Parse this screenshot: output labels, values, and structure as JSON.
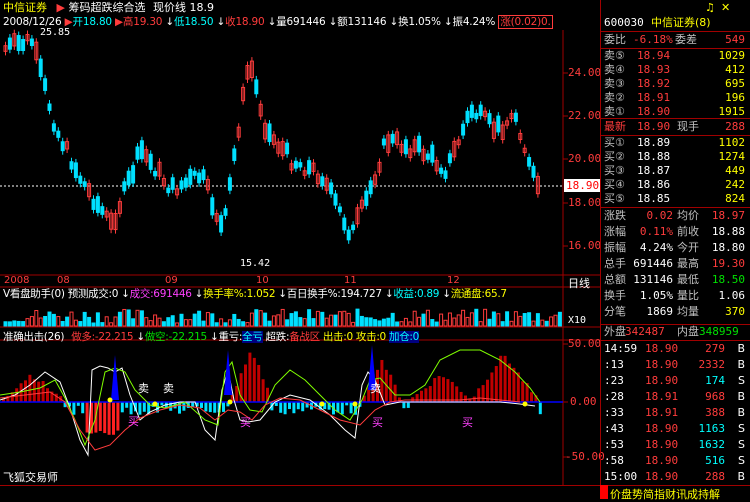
{
  "app": {
    "title": "中信证券",
    "icon_bell": "bell-icon"
  },
  "header": {
    "indicator_name": "筹码超跌综合选",
    "price_line": "现价线 18.9",
    "date": "2008/12/26",
    "open": "开18.80",
    "high": "高19.30",
    "low": "低18.50",
    "close": "收18.90",
    "volume": "量691446",
    "amount": "额131146",
    "turnover": "换1.05%",
    "amplitude": "振4.24%",
    "change": "涨(0.02)0."
  },
  "price_chart": {
    "high_label": "25.85",
    "low_label": "15.42",
    "current_tag": "18.90",
    "axis": [
      "24.00",
      "22.00",
      "20.00",
      "18.00",
      "16.00"
    ],
    "x_labels": [
      "2008",
      "08",
      "09",
      "10",
      "11",
      "12"
    ],
    "period": "日线"
  },
  "volume_panel": {
    "title": "V看盘助手(0)",
    "prefix": "预测成交:0",
    "vol": "成交:691446",
    "turn": "换手率%:1.052",
    "hundred": "百日换手%:194.727",
    "income": "收益:0.89",
    "float": "流通盘:65.7",
    "unit": "X10"
  },
  "bottom_panel": {
    "title": "准确出击(26)",
    "bull": "做多:-22.215",
    "bear": "做空:-22.215",
    "loss_label": "重亏:",
    "loss_val": "全亏",
    "plunge_label": "超跌:",
    "plunge_val": "备战区",
    "exit": "出击:0",
    "attack": "攻击:0",
    "add": "加仓:0",
    "axis": [
      "50.00",
      "0.00",
      "-50.00"
    ],
    "buy_marks": [
      "买",
      "买",
      "买",
      "买"
    ],
    "sell_marks": [
      "卖",
      "卖",
      "卖"
    ],
    "watermark": "飞狐交易师"
  },
  "quote": {
    "code": "600030",
    "name": "中信证券(8)",
    "ratio_label": "委比",
    "ratio_val": "-6.18%",
    "diff_label": "委差",
    "diff_val": "549",
    "asks": [
      {
        "label": "卖⑤",
        "price": "18.94",
        "vol": "1029"
      },
      {
        "label": "卖④",
        "price": "18.93",
        "vol": "412"
      },
      {
        "label": "卖③",
        "price": "18.92",
        "vol": "695"
      },
      {
        "label": "卖②",
        "price": "18.91",
        "vol": "196"
      },
      {
        "label": "卖①",
        "price": "18.90",
        "vol": "1915"
      }
    ],
    "last_label": "最新",
    "last_val": "18.90",
    "hand_label": "现手",
    "hand_val": "288",
    "bids": [
      {
        "label": "买①",
        "price": "18.89",
        "vol": "1102"
      },
      {
        "label": "买②",
        "price": "18.88",
        "vol": "1274"
      },
      {
        "label": "买③",
        "price": "18.87",
        "vol": "449"
      },
      {
        "label": "买④",
        "price": "18.86",
        "vol": "242"
      },
      {
        "label": "买⑤",
        "price": "18.85",
        "vol": "824"
      }
    ],
    "stats": [
      {
        "l1": "涨跌",
        "v1": "0.02",
        "l2": "均价",
        "v2": "18.97"
      },
      {
        "l1": "涨幅",
        "v1": "0.11%",
        "l2": "前收",
        "v2": "18.88"
      },
      {
        "l1": "振幅",
        "v1": "4.24%",
        "l2": "今开",
        "v2": "18.80"
      },
      {
        "l1": "总手",
        "v1": "691446",
        "l2": "最高",
        "v2": "19.30"
      },
      {
        "l1": "总额",
        "v1": "131146",
        "l2": "最低",
        "v2": "18.50"
      },
      {
        "l1": "换手",
        "v1": "1.05%",
        "l2": "量比",
        "v2": "1.06"
      },
      {
        "l1": "分笔",
        "v1": "1869",
        "l2": "均量",
        "v2": "370"
      }
    ],
    "outer_label": "外盘",
    "outer_val": "342487",
    "inner_label": "内盘",
    "inner_val": "348959",
    "ticks": [
      {
        "t": "14:59",
        "p": "18.90",
        "v": "279",
        "s": "B"
      },
      {
        "t": ":13",
        "p": "18.90",
        "v": "2332",
        "s": "B"
      },
      {
        "t": ":23",
        "p": "18.90",
        "v": "174",
        "s": "S"
      },
      {
        "t": ":28",
        "p": "18.91",
        "v": "968",
        "s": "B"
      },
      {
        "t": ":33",
        "p": "18.91",
        "v": "388",
        "s": "B"
      },
      {
        "t": ":43",
        "p": "18.90",
        "v": "1163",
        "s": "S"
      },
      {
        "t": ":53",
        "p": "18.90",
        "v": "1632",
        "s": "S"
      },
      {
        "t": ":58",
        "p": "18.90",
        "v": "516",
        "s": "S"
      },
      {
        "t": "15:00",
        "p": "18.90",
        "v": "288",
        "s": "B"
      }
    ]
  },
  "footer": {
    "text": "价盘势简指财讯成持解"
  }
}
